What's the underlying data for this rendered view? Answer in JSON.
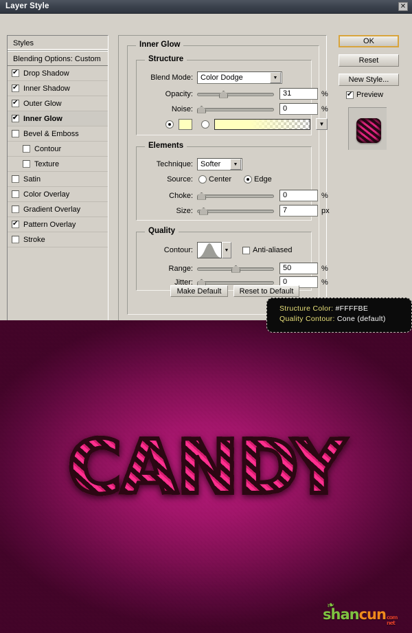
{
  "window": {
    "title": "Layer Style",
    "close_label": "✕"
  },
  "styles_panel": {
    "header": "Styles",
    "blending_options": "Blending Options: Custom",
    "items": [
      {
        "label": "Drop Shadow",
        "checked": true,
        "indent": false,
        "selected": false
      },
      {
        "label": "Inner Shadow",
        "checked": true,
        "indent": false,
        "selected": false
      },
      {
        "label": "Outer Glow",
        "checked": true,
        "indent": false,
        "selected": false
      },
      {
        "label": "Inner Glow",
        "checked": true,
        "indent": false,
        "selected": true
      },
      {
        "label": "Bevel & Emboss",
        "checked": false,
        "indent": false,
        "selected": false
      },
      {
        "label": "Contour",
        "checked": false,
        "indent": true,
        "selected": false
      },
      {
        "label": "Texture",
        "checked": false,
        "indent": true,
        "selected": false
      },
      {
        "label": "Satin",
        "checked": false,
        "indent": false,
        "selected": false
      },
      {
        "label": "Color Overlay",
        "checked": false,
        "indent": false,
        "selected": false
      },
      {
        "label": "Gradient Overlay",
        "checked": false,
        "indent": false,
        "selected": false
      },
      {
        "label": "Pattern Overlay",
        "checked": true,
        "indent": false,
        "selected": false
      },
      {
        "label": "Stroke",
        "checked": false,
        "indent": false,
        "selected": false
      }
    ]
  },
  "panel": {
    "title": "Inner Glow",
    "structure": {
      "legend": "Structure",
      "blend_mode_label": "Blend Mode:",
      "blend_mode_value": "Color Dodge",
      "opacity_label": "Opacity:",
      "opacity_value": "31",
      "opacity_unit": "%",
      "noise_label": "Noise:",
      "noise_value": "0",
      "noise_unit": "%",
      "color_hex": "#FFFFBE",
      "fill_mode": "color"
    },
    "elements": {
      "legend": "Elements",
      "technique_label": "Technique:",
      "technique_value": "Softer",
      "source_label": "Source:",
      "source_center": "Center",
      "source_edge": "Edge",
      "source_selected": "Edge",
      "choke_label": "Choke:",
      "choke_value": "0",
      "choke_unit": "%",
      "size_label": "Size:",
      "size_value": "7",
      "size_unit": "px"
    },
    "quality": {
      "legend": "Quality",
      "contour_label": "Contour:",
      "contour_name": "Cone",
      "antialiased_label": "Anti-aliased",
      "antialiased_checked": false,
      "range_label": "Range:",
      "range_value": "50",
      "range_unit": "%",
      "jitter_label": "Jitter:",
      "jitter_value": "0",
      "jitter_unit": "%"
    },
    "make_default": "Make Default",
    "reset_to_default": "Reset to Default"
  },
  "buttons": {
    "ok": "OK",
    "reset": "Reset",
    "new_style": "New Style...",
    "preview_label": "Preview",
    "preview_checked": true
  },
  "tooltip": {
    "line1_key": "Structure Color: ",
    "line1_value": "#FFFFBE",
    "line2_key": "Quality Contour: ",
    "line2_value": "Cone (default)"
  },
  "canvas": {
    "artwork_text": "CANDY",
    "background_center_color": "#b51a78",
    "background_edge_color": "#420428",
    "stripe_pink": "#ff2f8f",
    "stripe_dark": "#2b0612"
  },
  "watermark": {
    "part1": "shan",
    "part2": "cun",
    "tld1": "com",
    "tld2": "net"
  }
}
